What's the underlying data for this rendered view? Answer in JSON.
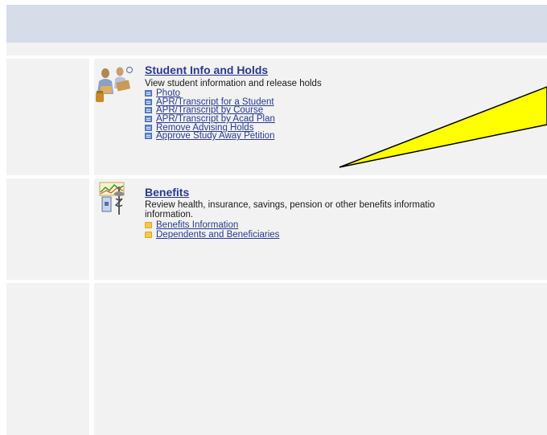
{
  "sections": [
    {
      "title": "Student Info and Holds",
      "description": "View student information and release holds",
      "icon": "students-with-books-icon",
      "links": [
        {
          "label": "Photo",
          "icon": "document-icon"
        },
        {
          "label": "APR/Transcript for a Student",
          "icon": "document-icon"
        },
        {
          "label": "APR/Transcript by Course",
          "icon": "document-icon"
        },
        {
          "label": "APR/Transcript by Acad Plan",
          "icon": "document-icon"
        },
        {
          "label": "Remove Advising Holds",
          "icon": "document-icon"
        },
        {
          "label": "Approve Study Away Petition",
          "icon": "document-icon"
        }
      ]
    },
    {
      "title": "Benefits",
      "description_line1": "Review health, insurance, savings, pension or other benefits informatio",
      "description_line2": "information.",
      "icon": "benefits-caduceus-chart-icon",
      "links": [
        {
          "label": "Benefits Information",
          "icon": "folder-icon"
        },
        {
          "label": "Dependents and Beneficiaries",
          "icon": "folder-icon"
        }
      ]
    }
  ],
  "colors": {
    "header": "#d6dde9",
    "panel": "#f2f2f2",
    "link": "#2a3b8f",
    "callout_fill": "#ffff00"
  }
}
